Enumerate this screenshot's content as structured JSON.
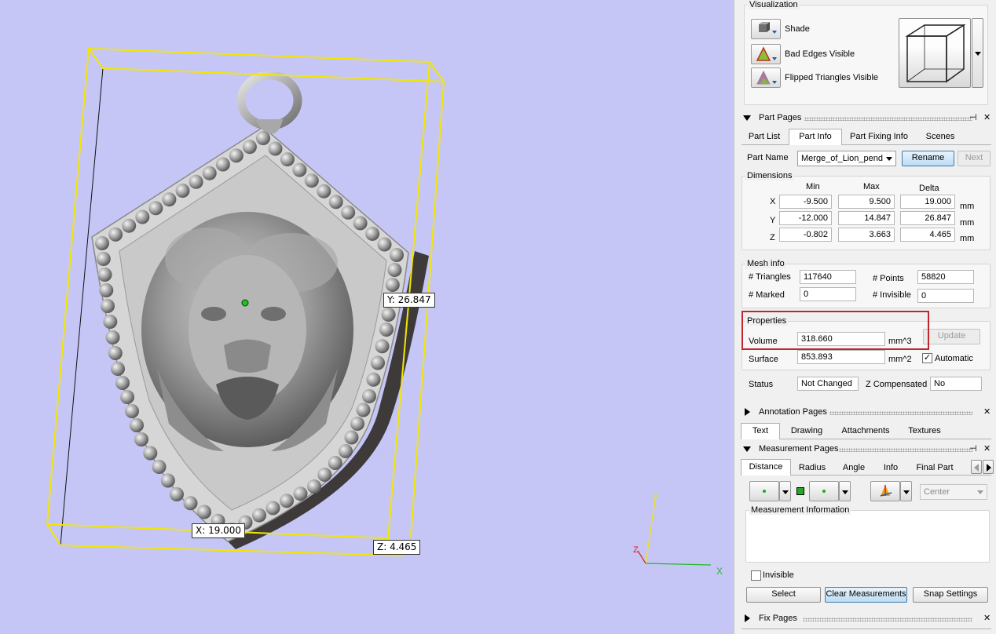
{
  "viewport": {
    "labels": {
      "x": "X: 19.000",
      "y": "Y: 26.847",
      "z": "Z: 4.465"
    },
    "axes": {
      "x": "X",
      "y": "Y",
      "z": "Z"
    }
  },
  "visualization": {
    "title": "Visualization",
    "shade": "Shade",
    "bad_edges": "Bad Edges Visible",
    "flipped": "Flipped Triangles Visible"
  },
  "part_pages": {
    "title": "Part Pages",
    "tabs": [
      "Part List",
      "Part Info",
      "Part Fixing Info",
      "Scenes"
    ],
    "active_tab": "Part Info",
    "part_name_label": "Part Name",
    "part_name": "Merge_of_Lion_pend",
    "rename": "Rename",
    "next": "Next",
    "dimensions": {
      "title": "Dimensions",
      "headers": [
        "Min",
        "Max",
        "Delta"
      ],
      "unit": "mm",
      "rows": [
        {
          "axis": "X",
          "min": "-9.500",
          "max": "9.500",
          "delta": "19.000"
        },
        {
          "axis": "Y",
          "min": "-12.000",
          "max": "14.847",
          "delta": "26.847"
        },
        {
          "axis": "Z",
          "min": "-0.802",
          "max": "3.663",
          "delta": "4.465"
        }
      ]
    },
    "mesh_info": {
      "title": "Mesh info",
      "triangles_label": "# Triangles",
      "triangles": "117640",
      "points_label": "# Points",
      "points": "58820",
      "marked_label": "# Marked",
      "marked": "0",
      "invisible_label": "# Invisible",
      "invisible": "0"
    },
    "properties": {
      "title": "Properties",
      "volume_label": "Volume",
      "volume": "318.660",
      "volume_unit": "mm^3",
      "surface_label": "Surface",
      "surface": "853.893",
      "surface_unit": "mm^2",
      "update": "Update",
      "automatic": "Automatic",
      "automatic_checked": true
    },
    "status_label": "Status",
    "status": "Not Changed",
    "zcomp_label": "Z Compensated",
    "zcomp": "No"
  },
  "annotation_pages": {
    "title": "Annotation Pages",
    "tabs": [
      "Text",
      "Drawing",
      "Attachments",
      "Textures"
    ],
    "active_tab": "Text"
  },
  "measurement_pages": {
    "title": "Measurement Pages",
    "tabs": [
      "Distance",
      "Radius",
      "Angle",
      "Info",
      "Final Part"
    ],
    "active_tab": "Distance",
    "center_option": "Center",
    "info_title": "Measurement Information",
    "invisible_label": "Invisible",
    "select": "Select",
    "clear": "Clear Measurements",
    "snap": "Snap Settings"
  },
  "fix_pages": {
    "title": "Fix Pages"
  },
  "colors": {
    "viewport_bg": "#c5c6f6",
    "highlight_box": "#c0262b",
    "bbox": "#f2e600"
  }
}
